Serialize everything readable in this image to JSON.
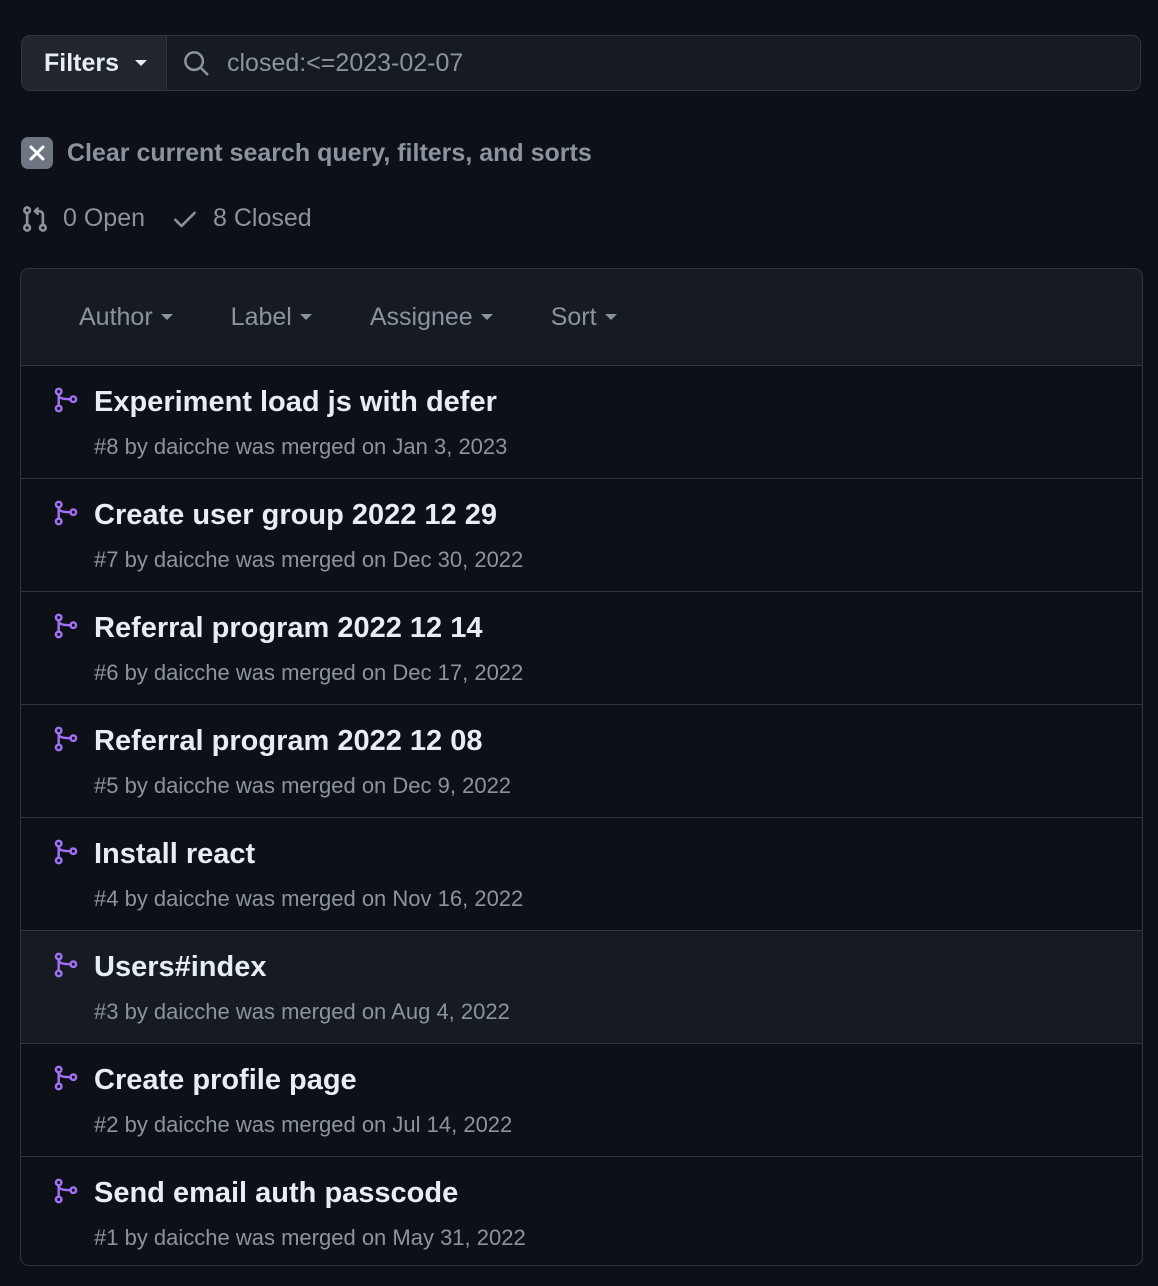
{
  "filters": {
    "button_label": "Filters",
    "search_value": "closed:<=2023-02-07"
  },
  "clear": {
    "label": "Clear current search query, filters, and sorts"
  },
  "states": {
    "open_label": "0 Open",
    "closed_label": "8 Closed"
  },
  "list_header": {
    "author": "Author",
    "label": "Label",
    "assignee": "Assignee",
    "sort": "Sort"
  },
  "colors": {
    "merged_icon": "#a371f7",
    "background": "#0d1117",
    "muted_text": "#8b949e"
  },
  "pull_requests": [
    {
      "title": "Experiment load js with defer",
      "meta": "#8 by daicche was merged on Jan 3, 2023",
      "icon": "git-merge-icon"
    },
    {
      "title": "Create user group 2022 12 29",
      "meta": "#7 by daicche was merged on Dec 30, 2022",
      "icon": "git-merge-icon"
    },
    {
      "title": "Referral program 2022 12 14",
      "meta": "#6 by daicche was merged on Dec 17, 2022",
      "icon": "git-merge-icon"
    },
    {
      "title": "Referral program 2022 12 08",
      "meta": "#5 by daicche was merged on Dec 9, 2022",
      "icon": "git-merge-icon"
    },
    {
      "title": "Install react",
      "meta": "#4 by daicche was merged on Nov 16, 2022",
      "icon": "git-merge-icon"
    },
    {
      "title": "Users#index",
      "meta": "#3 by daicche was merged on Aug 4, 2022",
      "icon": "git-merge-icon"
    },
    {
      "title": "Create profile page",
      "meta": "#2 by daicche was merged on Jul 14, 2022",
      "icon": "git-merge-icon"
    },
    {
      "title": "Send email auth passcode",
      "meta": "#1 by daicche was merged on May 31, 2022",
      "icon": "git-merge-icon"
    }
  ]
}
